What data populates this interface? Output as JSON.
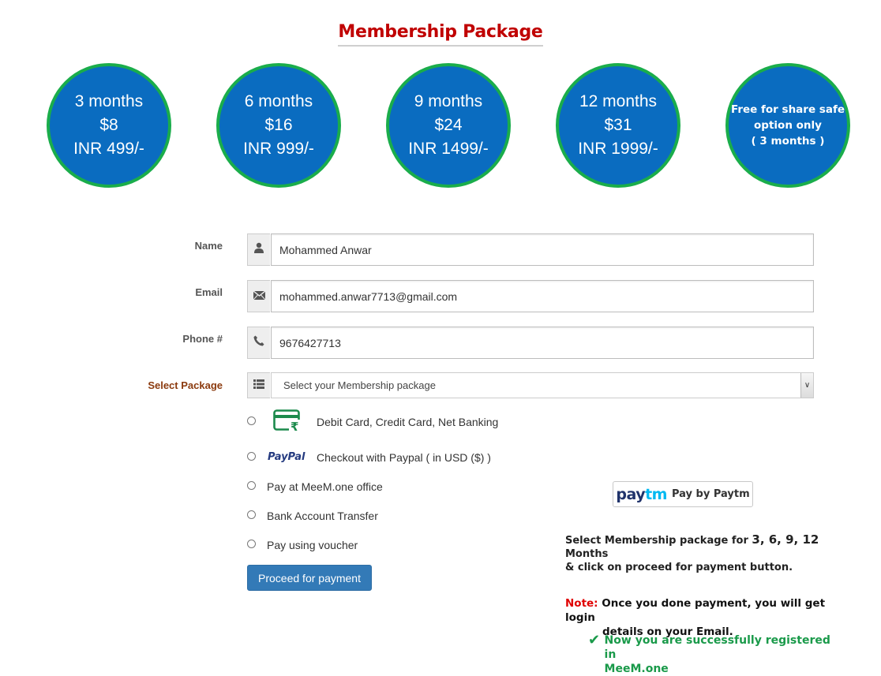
{
  "page": {
    "title": "Membership Package"
  },
  "packages": [
    {
      "duration": "3 months",
      "usd": "$8",
      "inr": "INR 499/-"
    },
    {
      "duration": "6 months",
      "usd": "$16",
      "inr": "INR 999/-"
    },
    {
      "duration": "9 months",
      "usd": "$24",
      "inr": "INR 1499/-"
    },
    {
      "duration": "12 months",
      "usd": "$31",
      "inr": "INR 1999/-"
    }
  ],
  "free_package": {
    "line1": "Free for share safe",
    "line2": "option only",
    "line3": "( 3 months )"
  },
  "form": {
    "name_label": "Name",
    "name_value": "Mohammed Anwar",
    "email_label": "Email",
    "email_value": "mohammed.anwar7713@gmail.com",
    "phone_label": "Phone #",
    "phone_value": "9676427713",
    "package_label": "Select Package",
    "package_selected": "Select your Membership package"
  },
  "payment_options": {
    "card": "Debit Card, Credit Card, Net Banking",
    "paypal": "Checkout with Paypal ( in USD ($) )",
    "paypal_logo": "PayPal",
    "office": "Pay at MeeM.one office",
    "bank": "Bank Account Transfer",
    "voucher": "Pay using voucher"
  },
  "proceed_button": "Proceed for payment",
  "paytm": {
    "logo_a": "pay",
    "logo_b": "tm",
    "label": "Pay by Paytm"
  },
  "info": {
    "text_pre": "Select Membership package for ",
    "months": "3, 6, 9, 12",
    "text_post": " Months",
    "line2": "& click on proceed for payment button."
  },
  "note": {
    "label": "Note:",
    "line1": " Once you done payment, you will get login",
    "line2": "details on your Email."
  },
  "success": {
    "line1": "Now  you  are successfully registered in",
    "line2": "MeeM.one"
  },
  "colors": {
    "title": "#c00000",
    "circle_fill": "#0a6cc0",
    "circle_border": "#1aad4b",
    "button": "#337ab7",
    "success": "#1a9a4a",
    "note_label": "#e00000"
  },
  "icons": {
    "name": "user-icon",
    "email": "envelope-icon",
    "phone": "phone-icon",
    "package": "list-icon",
    "card": "rupee-card-icon",
    "success": "check-icon"
  }
}
